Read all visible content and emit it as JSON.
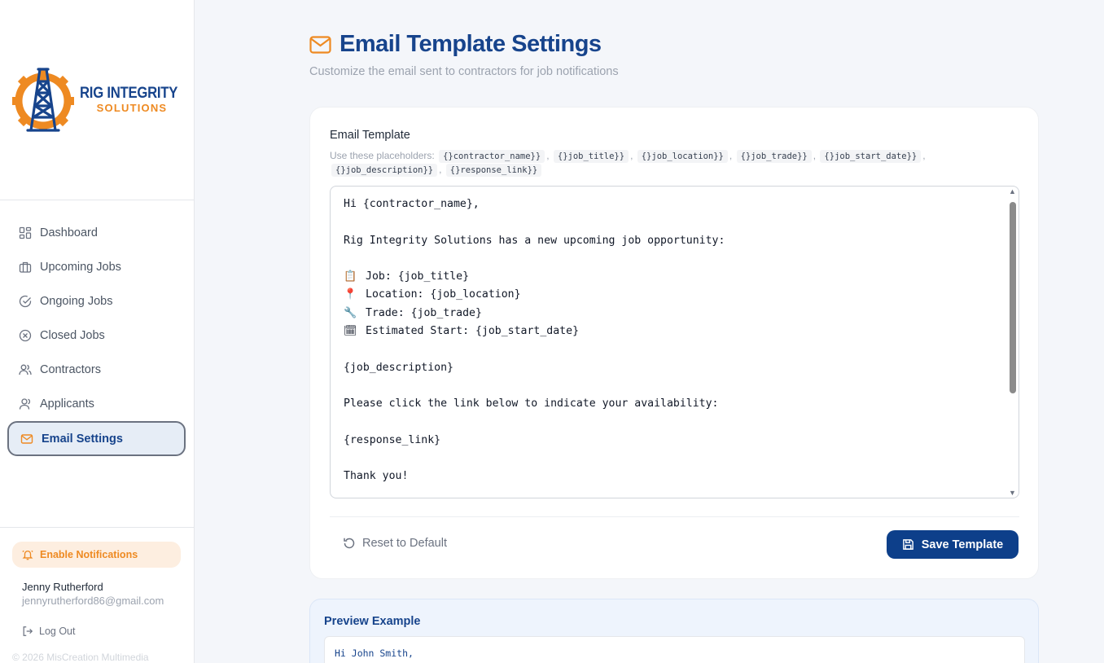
{
  "brand": {
    "name": "RIG INTEGRITY",
    "sub": "SOLUTIONS",
    "primary_color": "#17448c",
    "accent_color": "#ee8a22"
  },
  "sidebar": {
    "items": [
      {
        "label": "Dashboard",
        "icon": "dashboard-icon"
      },
      {
        "label": "Upcoming Jobs",
        "icon": "briefcase-icon"
      },
      {
        "label": "Ongoing Jobs",
        "icon": "check-circle-icon"
      },
      {
        "label": "Closed Jobs",
        "icon": "x-circle-icon"
      },
      {
        "label": "Contractors",
        "icon": "users-icon"
      },
      {
        "label": "Applicants",
        "icon": "user-icon"
      },
      {
        "label": "Email Settings",
        "icon": "mail-icon",
        "active": true
      }
    ],
    "notifications_label": "Enable Notifications",
    "user": {
      "name": "Jenny Rutherford",
      "email": "jennyrutherford86@gmail.com"
    },
    "logout_label": "Log Out",
    "copyright": "© 2026 MisCreation Multimedia"
  },
  "header": {
    "title": "Email Template Settings",
    "subtitle": "Customize the email sent to contractors for job notifications"
  },
  "template": {
    "label": "Email Template",
    "placeholders_intro": "Use these placeholders:",
    "placeholders": [
      "{}contractor_name}}",
      "{}job_title}}",
      "{}job_location}}",
      "{}job_trade}}",
      "{}job_start_date}}",
      "{}job_description}}",
      "{}response_link}}"
    ],
    "lines": [
      {
        "text": "Hi {contractor_name},"
      },
      {
        "text": ""
      },
      {
        "text": "Rig Integrity Solutions has a new upcoming job opportunity:"
      },
      {
        "text": ""
      },
      {
        "emoji": "📋",
        "text": "Job: {job_title}"
      },
      {
        "emoji": "📍",
        "text": "Location: {job_location}"
      },
      {
        "emoji": "🔧",
        "text": "Trade: {job_trade}"
      },
      {
        "emoji": "🗓",
        "text": "Estimated Start: {job_start_date}"
      },
      {
        "text": ""
      },
      {
        "text": "{job_description}"
      },
      {
        "text": ""
      },
      {
        "text": "Please click the link below to indicate your availability:"
      },
      {
        "text": ""
      },
      {
        "text": "{response_link}"
      },
      {
        "text": ""
      },
      {
        "text": "Thank you!"
      }
    ],
    "reset_label": "Reset to Default",
    "save_label": "Save Template"
  },
  "preview": {
    "title": "Preview Example",
    "first_line": "Hi John Smith,"
  }
}
